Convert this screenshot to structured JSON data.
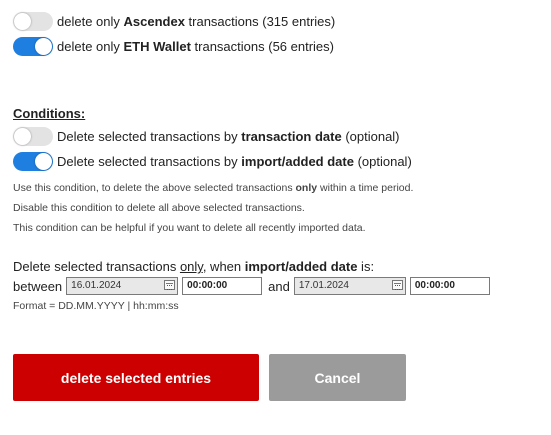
{
  "filters": [
    {
      "state": "off",
      "prefix": "delete only ",
      "name": "Ascendex",
      "suffix": " transactions (315 entries)"
    },
    {
      "state": "on",
      "prefix": "delete only ",
      "name": "ETH Wallet",
      "suffix": " transactions (56 entries)"
    }
  ],
  "conditions": {
    "heading": "Conditions:",
    "items": [
      {
        "state": "off",
        "prefix": "Delete selected transactions by ",
        "key": "transaction date",
        "suffix": " (optional)"
      },
      {
        "state": "on",
        "prefix": "Delete selected transactions by ",
        "key": "import/added date",
        "suffix": " (optional)"
      }
    ],
    "help": [
      {
        "before": "Use this condition, to delete the above selected transactions ",
        "bold": "only",
        "after": " within a time period."
      },
      {
        "before": "Disable this condition to delete all above selected transactions.",
        "bold": "",
        "after": ""
      },
      {
        "before": "This condition can be helpful if you want to delete all recently imported data.",
        "bold": "",
        "after": ""
      }
    ]
  },
  "range": {
    "line_prefix": "Delete selected transactions ",
    "line_only": "only",
    "line_middle": ", when ",
    "line_key": "import/added date",
    "line_suffix": " is:",
    "between_label": "between",
    "and_label": "and",
    "start_date": "16.01.2024",
    "start_time": "00:00:00",
    "end_date": "17.01.2024",
    "end_time": "00:00:00",
    "format": "Format = DD.MM.YYYY | hh:mm:ss"
  },
  "buttons": {
    "delete_label": "delete selected entries",
    "cancel_label": "Cancel"
  },
  "colors": {
    "toggle_on": "#1f7fe0",
    "toggle_off": "#e3e3e3",
    "delete_button": "#cc0000",
    "cancel_button": "#9b9b9b"
  }
}
